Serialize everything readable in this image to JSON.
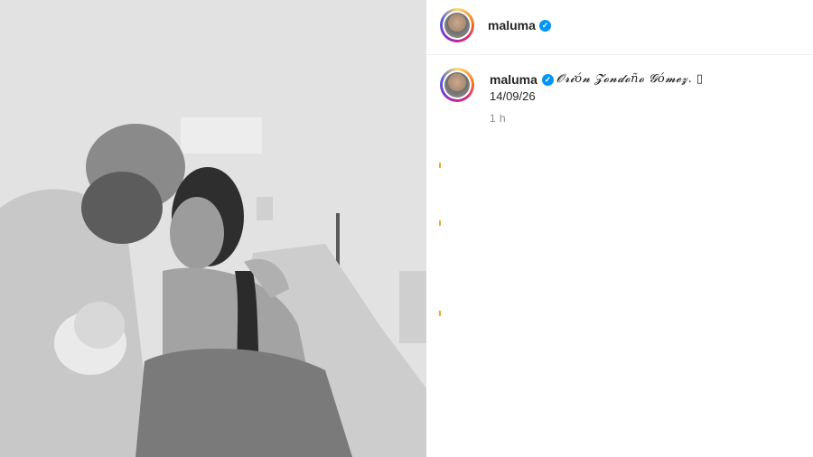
{
  "post": {
    "author": "maluma",
    "verified_icon": "verified-badge-icon",
    "caption_text": "𝓞𝓻𝓲ó𝓷 𝓩𝓸𝓷𝓭𝓸ñ𝓸 𝓖ó𝓶𝓮𝔃. ▯",
    "caption_date": "14/09/26",
    "time_ago": "1 h"
  },
  "colors": {
    "verified": "#0095f6",
    "username": "#262626",
    "muted": "#8e8e8e"
  }
}
